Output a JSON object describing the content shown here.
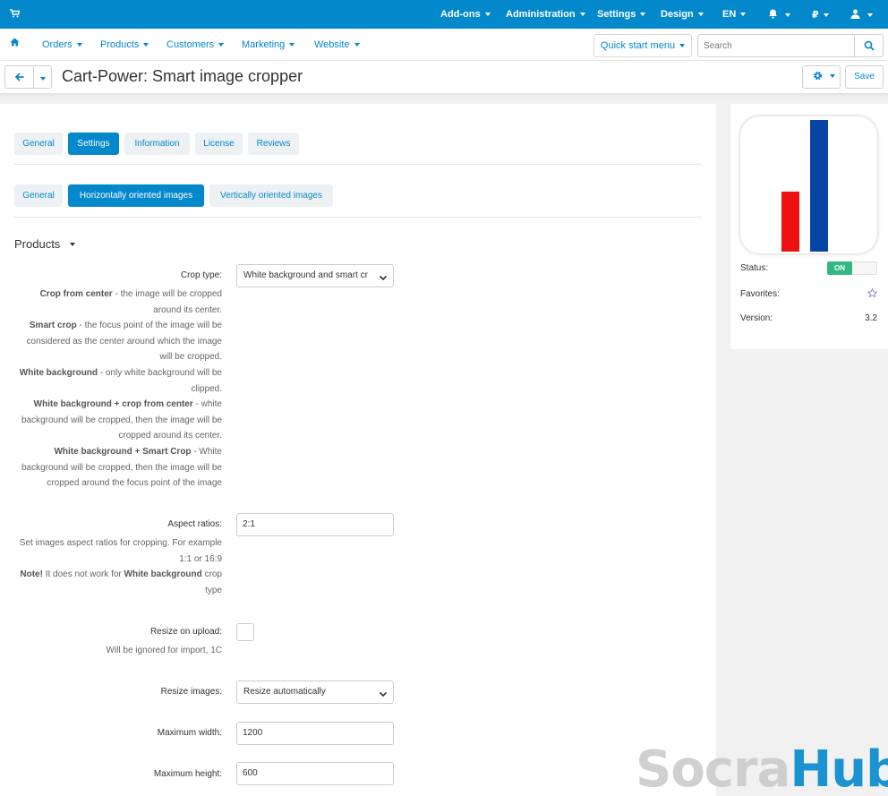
{
  "topbar": {
    "menus": [
      "Add-ons",
      "Administration",
      "Settings",
      "Design",
      "EN",
      "₽"
    ]
  },
  "navbar": {
    "items": [
      "Orders",
      "Products",
      "Customers",
      "Marketing",
      "Website"
    ],
    "quick_start": "Quick start menu",
    "search_placeholder": "Search"
  },
  "titlebar": {
    "title": "Cart-Power: Smart image cropper",
    "save_label": "Save"
  },
  "tabs": [
    "General",
    "Settings",
    "Information",
    "License",
    "Reviews"
  ],
  "subtabs": [
    "General",
    "Horizontally oriented images",
    "Vertically oriented images"
  ],
  "section": "Products",
  "fields": {
    "crop_type": {
      "label": "Crop type:",
      "value": "White background and smart cr",
      "help": [
        {
          "b": "Crop from center",
          "t": " - the image will be cropped around its center."
        },
        {
          "b": "Smart crop",
          "t": " - the focus point of the image will be considered as the center around which the image will be cropped."
        },
        {
          "b": "White background",
          "t": " - only white background will be clipped."
        },
        {
          "b": "White background + crop from center",
          "t": " - white background will be cropped, then the image will be cropped around its center."
        },
        {
          "b": "White background + Smart Crop",
          "t": " - White background will be cropped, then the image will be cropped around the focus point of the image"
        }
      ]
    },
    "aspect": {
      "label": "Aspect ratios:",
      "value": "2:1",
      "help1": "Set images aspect ratios for cropping. For example 1:1 or 16:9",
      "note_b": "Note!",
      "note_t": " It does not work for ",
      "note_b2": "White background",
      "note_t2": " crop type"
    },
    "resize_upload": {
      "label": "Resize on upload:",
      "help": "Will be ignored for import, 1C"
    },
    "resize_images": {
      "label": "Resize images:",
      "value": "Resize automatically"
    },
    "max_width": {
      "label": "Maximum width:",
      "value": "1200"
    },
    "max_height": {
      "label": "Maximum height:",
      "value": "600"
    }
  },
  "sidebar": {
    "status_label": "Status:",
    "status_value": "ON",
    "favorites_label": "Favorites:",
    "version_label": "Version:",
    "version_value": "3.2"
  },
  "watermark": {
    "part1": "Socra",
    "part2": "Hub"
  },
  "colors": {
    "accent": "#0388cc",
    "status_on": "#31b983",
    "logo_red": "#ee1111",
    "logo_blue": "#0844a4"
  }
}
